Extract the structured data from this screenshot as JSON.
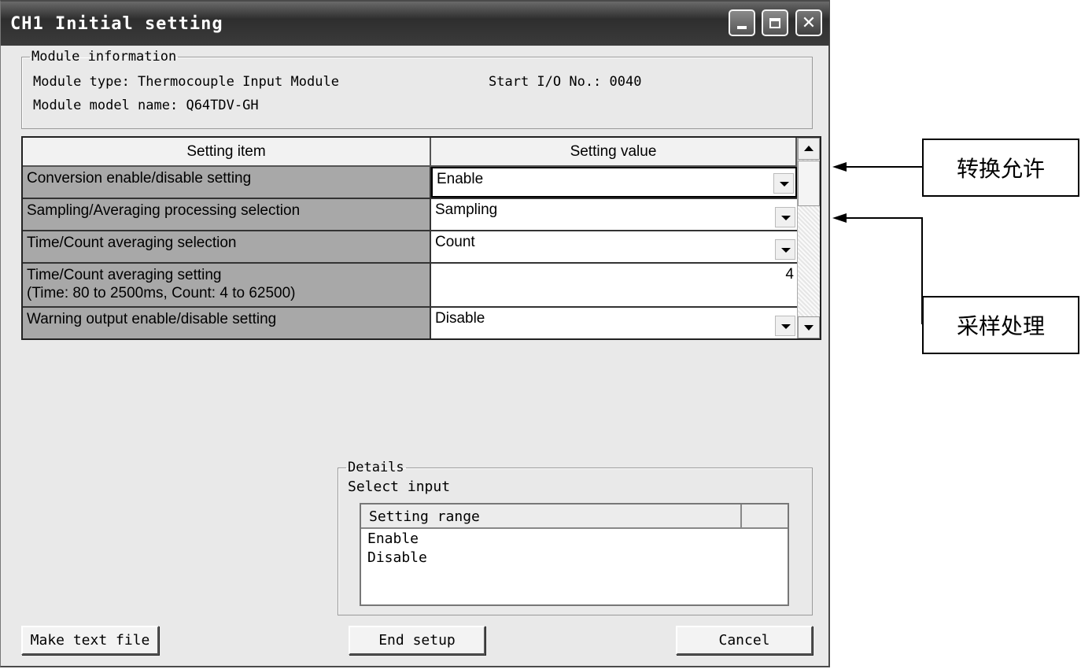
{
  "window": {
    "title": "CH1 Initial setting"
  },
  "module_info": {
    "legend": "Module information",
    "type_line": "Module type: Thermocouple Input Module",
    "start_io": "Start I/O No.: 0040",
    "model_line": "Module model name: Q64TDV-GH"
  },
  "grid": {
    "headers": [
      "Setting item",
      "Setting value"
    ],
    "rows": [
      {
        "item": "Conversion enable/disable setting",
        "value": "Enable",
        "type": "dropdown"
      },
      {
        "item": "Sampling/Averaging processing selection",
        "value": "Sampling",
        "type": "dropdown"
      },
      {
        "item": "Time/Count averaging selection",
        "value": "Count",
        "type": "dropdown"
      },
      {
        "item": "Time/Count averaging setting",
        "item2": "(Time: 80 to 2500ms, Count: 4 to 62500)",
        "value": "4",
        "type": "number"
      },
      {
        "item": "Warning output enable/disable setting",
        "value": "Disable",
        "type": "dropdown"
      }
    ]
  },
  "details": {
    "legend": "Details",
    "prompt": "Select input",
    "list_header": "Setting range",
    "items": [
      "Enable",
      "Disable"
    ]
  },
  "buttons": {
    "make_text": "Make text file",
    "end_setup": "End setup",
    "cancel": "Cancel"
  },
  "annotations": {
    "label1": "转换允许",
    "label2": "采样处理"
  }
}
